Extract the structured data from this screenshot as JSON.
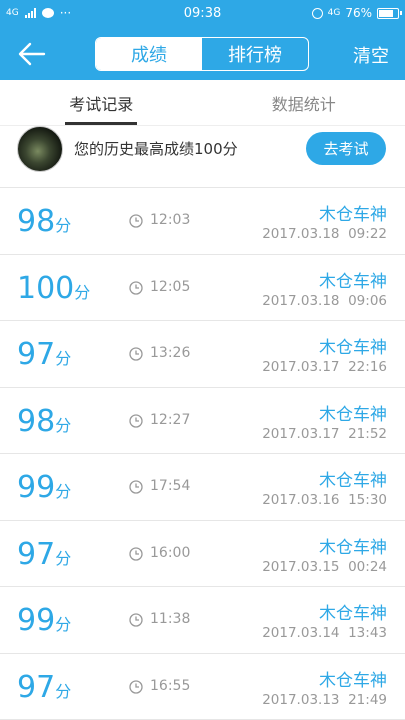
{
  "status_bar": {
    "network": "4G",
    "time": "09:38",
    "network_right": "4G",
    "battery": "76%",
    "more": "···"
  },
  "header": {
    "tabs": [
      "成绩",
      "排行榜"
    ],
    "clear_label": "清空"
  },
  "sub_tabs": [
    "考试记录",
    "数据统计"
  ],
  "banner": {
    "best_text": "您的历史最高成绩100分",
    "exam_button": "去考试"
  },
  "score_unit": "分",
  "records": [
    {
      "score": "98",
      "duration": "12:03",
      "name": "木仓车神",
      "date": "2017.03.18",
      "time": "09:22"
    },
    {
      "score": "100",
      "duration": "12:05",
      "name": "木仓车神",
      "date": "2017.03.18",
      "time": "09:06"
    },
    {
      "score": "97",
      "duration": "13:26",
      "name": "木仓车神",
      "date": "2017.03.17",
      "time": "22:16"
    },
    {
      "score": "98",
      "duration": "12:27",
      "name": "木仓车神",
      "date": "2017.03.17",
      "time": "21:52"
    },
    {
      "score": "99",
      "duration": "17:54",
      "name": "木仓车神",
      "date": "2017.03.16",
      "time": "15:30"
    },
    {
      "score": "97",
      "duration": "16:00",
      "name": "木仓车神",
      "date": "2017.03.15",
      "time": "00:24"
    },
    {
      "score": "99",
      "duration": "11:38",
      "name": "木仓车神",
      "date": "2017.03.14",
      "time": "13:43"
    },
    {
      "score": "97",
      "duration": "16:55",
      "name": "木仓车神",
      "date": "2017.03.13",
      "time": "21:49"
    }
  ],
  "colors": {
    "accent": "#2ea8e6"
  }
}
